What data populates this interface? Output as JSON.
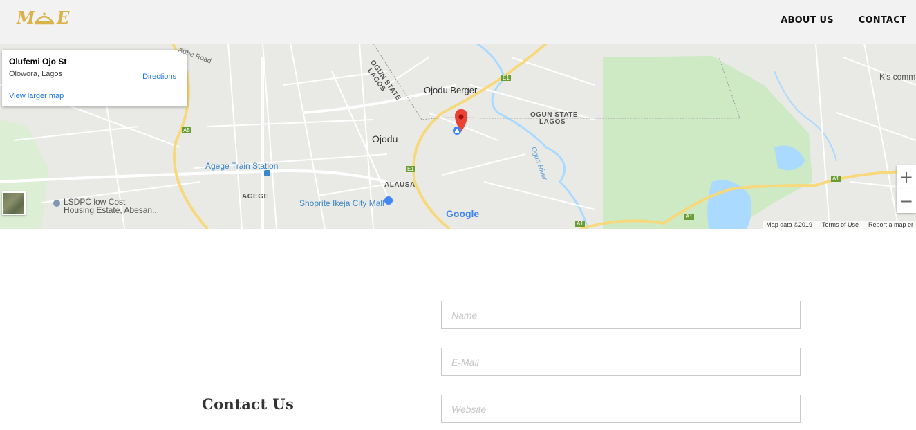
{
  "header": {
    "logo_text": "M E",
    "nav": [
      {
        "label": "ABOUT US"
      },
      {
        "label": "CONTACT"
      }
    ]
  },
  "map": {
    "infocard": {
      "title": "Olufemi Ojo St",
      "subtitle": "Olowora, Lagos",
      "directions": "Directions",
      "larger_map": "View larger map"
    },
    "labels": {
      "ojodu_berger": "Ojodu Berger",
      "ojodu": "Ojodu",
      "agege_train": "Agege Train Station",
      "agege": "AGEGE",
      "alausa": "ALAUSA",
      "shoprite": "Shoprite Ikeja City Mall",
      "lsdpc": "LSDPC low Cost",
      "housing": "Housing Estate, Abesan...",
      "ogun_state": "OGUN STATE",
      "lagos": "LAGOS",
      "ogun_state_diag": "OGUN STATE",
      "lagos_diag": "LAGOS",
      "ogun_river": "Ogun River",
      "ks_comm": "K's comm",
      "agbe_road": "Agbe Road",
      "a5": "A5",
      "e1a": "E1",
      "e1b": "E1",
      "a1a": "A1",
      "a1b": "A1",
      "a1c": "A1"
    },
    "google": "Google",
    "attribution": {
      "data": "Map data ©2019",
      "terms": "Terms of Use",
      "report": "Report a map er"
    },
    "zoom_in": "+",
    "zoom_out": "−"
  },
  "contact": {
    "title": "Contact Us",
    "fields": {
      "name_placeholder": "Name",
      "email_placeholder": "E-Mail",
      "website_placeholder": "Website"
    }
  },
  "colors": {
    "logo_gold": "#d9b24a",
    "header_bg": "#f2f2f2",
    "map_bg": "#e9e9e6",
    "park_green": "#cdeac4",
    "water_blue": "#aadaff",
    "highway_yellow": "#f7d97b",
    "pin_red": "#ea4335",
    "link_blue": "#1a73e8"
  }
}
